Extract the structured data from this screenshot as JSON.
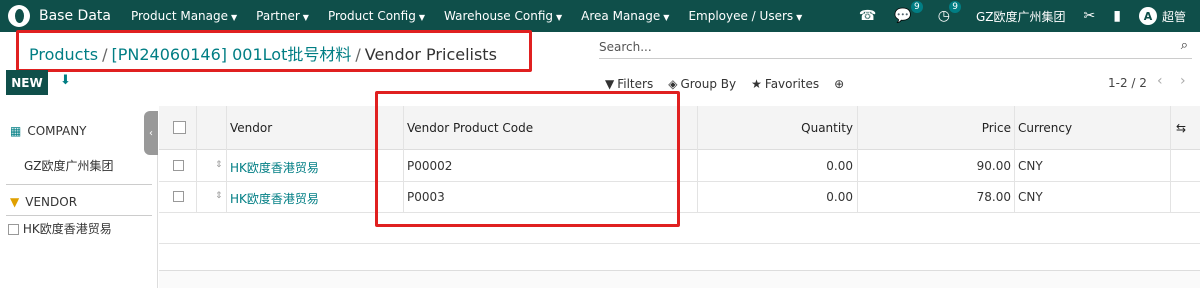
{
  "navbar": {
    "app_title": "Base Data",
    "menus": [
      "Product Manage",
      "Partner",
      "Product Config",
      "Warehouse Config",
      "Area Manage",
      "Employee / Users"
    ],
    "phone_icon": "phone-icon",
    "messages_badge": "9",
    "activities_badge": "9",
    "company": "GZ欧度广州集团",
    "avatar_initial": "A",
    "user_name": "超管",
    "accent_color": "#0f4f4a"
  },
  "breadcrumb": {
    "level1": "Products",
    "level2": "[PN24060146] 001Lot批号材料",
    "current": "Vendor Pricelists"
  },
  "search": {
    "placeholder": "Search..."
  },
  "toolbar": {
    "new_label": "NEW"
  },
  "filters": {
    "filters_label": "Filters",
    "groupby_label": "Group By",
    "favorites_label": "Favorites"
  },
  "pager": {
    "value": "1-2 / 2"
  },
  "side_panel": {
    "company_header": "COMPANY",
    "company_item": "GZ欧度广州集团",
    "vendor_header": "VENDOR",
    "vendor_item": "HK欧度香港贸易"
  },
  "table": {
    "columns": {
      "vendor": "Vendor",
      "vendor_product_code": "Vendor Product Code",
      "quantity": "Quantity",
      "price": "Price",
      "currency": "Currency"
    },
    "rows": [
      {
        "vendor": "HK欧度香港贸易",
        "code": "P00002",
        "quantity": "0.00",
        "price": "90.00",
        "currency": "CNY"
      },
      {
        "vendor": "HK欧度香港贸易",
        "code": "P0003",
        "quantity": "0.00",
        "price": "78.00",
        "currency": "CNY"
      }
    ]
  }
}
